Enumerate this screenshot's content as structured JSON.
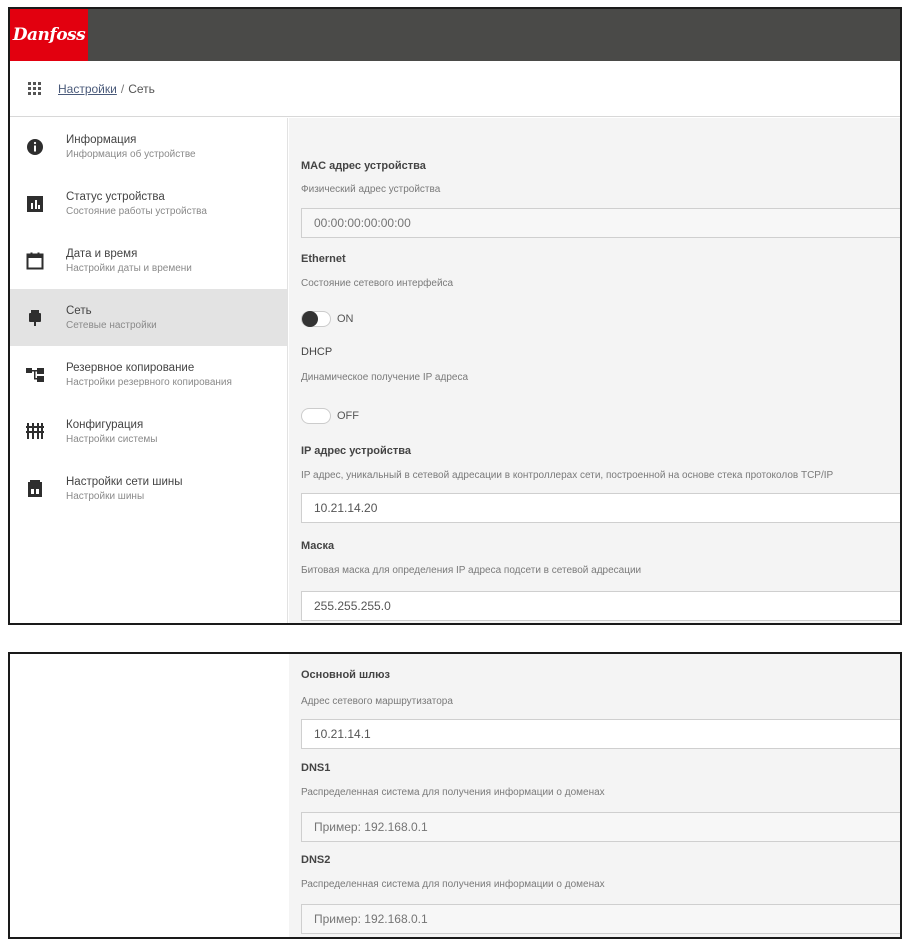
{
  "brand": {
    "logo_text": "Danfoss",
    "accent": "#e2000f",
    "topbar_color": "#4a4a48"
  },
  "breadcrumb": {
    "parent": "Настройки",
    "separator": "/",
    "current": "Сеть"
  },
  "sidebar": {
    "items": [
      {
        "title": "Информация",
        "subtitle": "Информация об устройстве",
        "icon": "info-icon"
      },
      {
        "title": "Статус устройства",
        "subtitle": "Состояние работы устройства",
        "icon": "status-icon"
      },
      {
        "title": "Дата и время",
        "subtitle": "Настройки даты и времени",
        "icon": "calendar-icon"
      },
      {
        "title": "Сеть",
        "subtitle": "Сетевые настройки",
        "icon": "network-icon",
        "active": true
      },
      {
        "title": "Резервное копирование",
        "subtitle": "Настройки резервного копирования",
        "icon": "backup-icon"
      },
      {
        "title": "Конфигурация",
        "subtitle": "Настройки системы",
        "icon": "config-icon"
      },
      {
        "title": "Настройки сети шины",
        "subtitle": "Настройки шины",
        "icon": "bus-icon"
      }
    ]
  },
  "form": {
    "mac": {
      "label": "MAC адрес устройства",
      "desc": "Физический адрес устройства",
      "placeholder": "00:00:00:00:00:00"
    },
    "ethernet": {
      "label": "Ethernet",
      "desc": "Состояние сетевого интерфейса",
      "toggle": "ON"
    },
    "dhcp": {
      "label": "DHCP",
      "desc": "Динамическое получение IP адреса",
      "toggle": "OFF"
    },
    "ip": {
      "label": "IP адрес устройства",
      "desc": "IP адрес, уникальный в сетевой адресации в контроллерах сети, построенной на основе стека протоколов TCP/IP",
      "value": "10.21.14.20"
    },
    "mask": {
      "label": "Маска",
      "desc": "Битовая маска для определения IP адреса подсети в сетевой адресации",
      "value": "255.255.255.0"
    },
    "gateway": {
      "label": "Основной шлюз",
      "desc": "Адрес сетевого маршрутизатора",
      "value": "10.21.14.1"
    },
    "dns1": {
      "label": "DNS1",
      "desc": "Распределенная система для получения информации о доменах",
      "placeholder": "Пример: 192.168.0.1"
    },
    "dns2": {
      "label": "DNS2",
      "desc": "Распределенная система для получения информации о доменах",
      "placeholder": "Пример: 192.168.0.1"
    }
  }
}
